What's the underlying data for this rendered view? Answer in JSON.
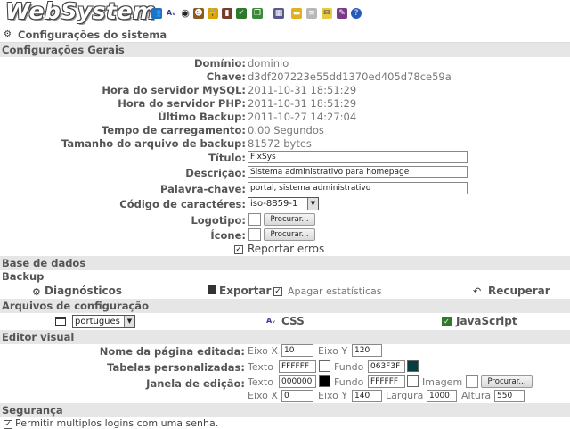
{
  "header": {
    "logo": "WebSystem",
    "toolbar_icons": [
      "users-icon",
      "spell-icon",
      "target-icon",
      "people-icon",
      "lock-icon",
      "books-icon",
      "checklist-icon",
      "windows-icon",
      "table-icon",
      "folder-icon",
      "notes-icon",
      "mail-icon",
      "edit-icon",
      "help-icon"
    ]
  },
  "page_title": "Configurações do sistema",
  "general": {
    "heading": "Configurações Gerais",
    "info": [
      {
        "label": "Domínio:",
        "value": "dominio"
      },
      {
        "label": "Chave:",
        "value": "d3df207223e55dd1370ed405d78ce59a"
      },
      {
        "label": "Hora do servidor MySQL:",
        "value": "2011-10-31 18:51:29"
      },
      {
        "label": "Hora do servidor PHP:",
        "value": "2011-10-31 18:51:29"
      },
      {
        "label": "Último Backup:",
        "value": "2011-10-27 14:27:04"
      },
      {
        "label": "Tempo de carregamento:",
        "value": "0.00 Segundos"
      },
      {
        "label": "Tamanho do arquivo de backup:",
        "value": "81572 bytes"
      }
    ],
    "title_label": "Título:",
    "title_value": "FlxSys",
    "desc_label": "Descrição:",
    "desc_value": "Sistema administrativo para homepage",
    "keyword_label": "Palavra-chave:",
    "keyword_value": "portal, sistema administrativo",
    "charset_label": "Código de caractéres:",
    "charset_value": "iso-8859-1",
    "logo_label": "Logotipo:",
    "icon_label": "Ícone:",
    "browse": "Procurar...",
    "report_errors": "Reportar erros"
  },
  "database": {
    "heading": "Base de dados",
    "backup": "Backup",
    "diagnostics": "Diagnósticos",
    "export": "Exportar",
    "clear_stats": "Apagar estatísticas",
    "restore": "Recuperar"
  },
  "config_files": {
    "heading": "Arquivos de configuração",
    "language": "portugues",
    "css": "CSS",
    "js": "JavaScript"
  },
  "visual_editor": {
    "heading": "Editor visual",
    "page_name_label": "Nome da página editada:",
    "custom_tables_label": "Tabelas personalizadas:",
    "edit_window_label": "Janela de edição:",
    "eixo_x": "Eixo X",
    "eixo_y": "Eixo Y",
    "texto": "Texto",
    "fundo": "Fundo",
    "imagem": "Imagem",
    "largura": "Largura",
    "altura": "Altura",
    "page_x": "10",
    "page_y": "120",
    "tables_text": "FFFFFF",
    "tables_bg": "063F3F",
    "win_text": "000000",
    "win_bg": "FFFFFF",
    "win_x": "0",
    "win_y": "140",
    "win_w": "1000",
    "win_h": "550",
    "browse": "Procurar...",
    "colors": {
      "white": "#FFFFFF",
      "dark_teal": "#063F3F",
      "black": "#000000"
    }
  },
  "security": {
    "heading": "Segurança",
    "multi_login": "Permitir multiplos logins com uma senha."
  }
}
